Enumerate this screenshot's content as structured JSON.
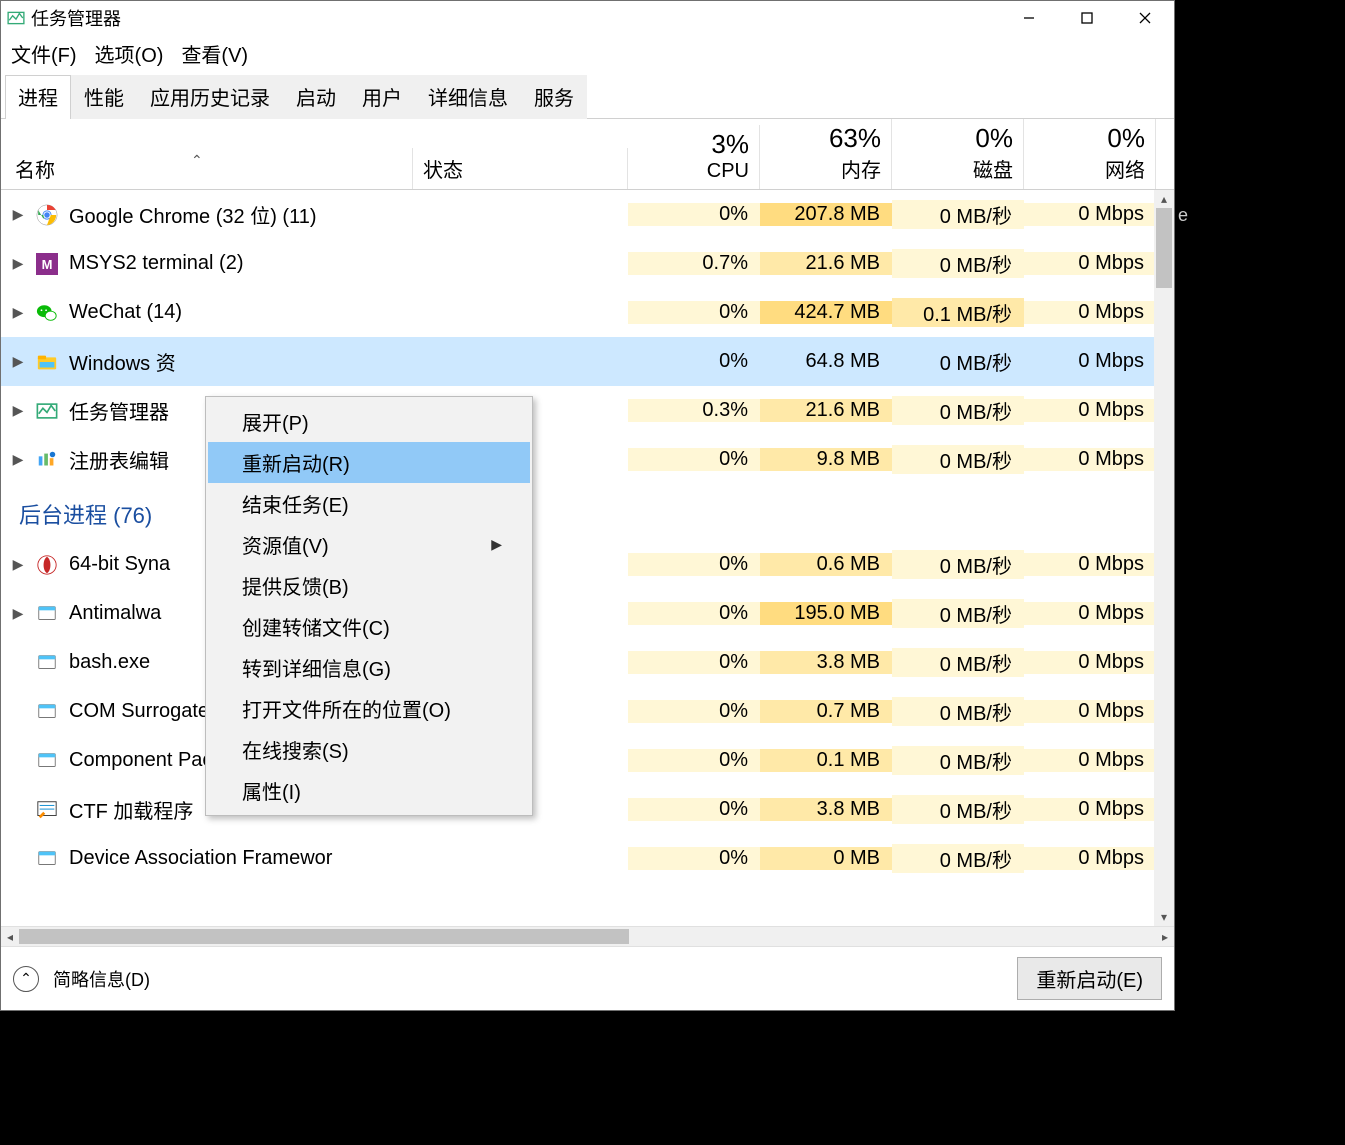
{
  "window": {
    "title": "任务管理器"
  },
  "menubar": {
    "file": "文件(F)",
    "options": "选项(O)",
    "view": "查看(V)"
  },
  "tabs": {
    "items": [
      {
        "label": "进程",
        "active": true
      },
      {
        "label": "性能",
        "active": false
      },
      {
        "label": "应用历史记录",
        "active": false
      },
      {
        "label": "启动",
        "active": false
      },
      {
        "label": "用户",
        "active": false
      },
      {
        "label": "详细信息",
        "active": false
      },
      {
        "label": "服务",
        "active": false
      }
    ]
  },
  "columns": {
    "name": "名称",
    "status": "状态",
    "metrics": [
      {
        "value": "3%",
        "label": "CPU"
      },
      {
        "value": "63%",
        "label": "内存"
      },
      {
        "value": "0%",
        "label": "磁盘"
      },
      {
        "value": "0%",
        "label": "网络"
      }
    ]
  },
  "group_bg_label": "后台进程 (76)",
  "processes": [
    {
      "expandable": true,
      "icon": "chrome",
      "name": "Google Chrome (32 位) (11)",
      "cpu": "0%",
      "mem": "207.8 MB",
      "disk": "0 MB/秒",
      "net": "0 Mbps",
      "heat": [
        "low",
        "hi",
        "low",
        "low"
      ],
      "selected": false
    },
    {
      "expandable": true,
      "icon": "msys",
      "name": "MSYS2 terminal (2)",
      "cpu": "0.7%",
      "mem": "21.6 MB",
      "disk": "0 MB/秒",
      "net": "0 Mbps",
      "heat": [
        "low",
        "med",
        "low",
        "low"
      ],
      "selected": false
    },
    {
      "expandable": true,
      "icon": "wechat",
      "name": "WeChat (14)",
      "cpu": "0%",
      "mem": "424.7 MB",
      "disk": "0.1 MB/秒",
      "net": "0 Mbps",
      "heat": [
        "low",
        "hi",
        "med",
        "low"
      ],
      "selected": false
    },
    {
      "expandable": true,
      "icon": "explorer",
      "name": "Windows 资",
      "cpu": "0%",
      "mem": "64.8 MB",
      "disk": "0 MB/秒",
      "net": "0 Mbps",
      "heat": [
        "low",
        "med",
        "low",
        "low"
      ],
      "selected": true
    },
    {
      "expandable": true,
      "icon": "taskmgr",
      "name": "任务管理器",
      "cpu": "0.3%",
      "mem": "21.6 MB",
      "disk": "0 MB/秒",
      "net": "0 Mbps",
      "heat": [
        "low",
        "med",
        "low",
        "low"
      ],
      "selected": false
    },
    {
      "expandable": true,
      "icon": "regedit",
      "name": "注册表编辑",
      "cpu": "0%",
      "mem": "9.8 MB",
      "disk": "0 MB/秒",
      "net": "0 Mbps",
      "heat": [
        "low",
        "med",
        "low",
        "low"
      ],
      "selected": false
    }
  ],
  "bg_processes": [
    {
      "expandable": true,
      "icon": "synaptic",
      "name": "64-bit Syna",
      "cpu": "0%",
      "mem": "0.6 MB",
      "disk": "0 MB/秒",
      "net": "0 Mbps",
      "heat": [
        "low",
        "med",
        "low",
        "low"
      ]
    },
    {
      "expandable": true,
      "icon": "generic",
      "name": "Antimalwa",
      "cpu": "0%",
      "mem": "195.0 MB",
      "disk": "0 MB/秒",
      "net": "0 Mbps",
      "heat": [
        "low",
        "hi",
        "low",
        "low"
      ]
    },
    {
      "expandable": false,
      "icon": "generic",
      "name": "bash.exe",
      "cpu": "0%",
      "mem": "3.8 MB",
      "disk": "0 MB/秒",
      "net": "0 Mbps",
      "heat": [
        "low",
        "med",
        "low",
        "low"
      ]
    },
    {
      "expandable": false,
      "icon": "generic",
      "name": "COM Surrogate",
      "cpu": "0%",
      "mem": "0.7 MB",
      "disk": "0 MB/秒",
      "net": "0 Mbps",
      "heat": [
        "low",
        "med",
        "low",
        "low"
      ]
    },
    {
      "expandable": false,
      "icon": "generic",
      "name": "Component Package Support...",
      "cpu": "0%",
      "mem": "0.1 MB",
      "disk": "0 MB/秒",
      "net": "0 Mbps",
      "heat": [
        "low",
        "med",
        "low",
        "low"
      ]
    },
    {
      "expandable": false,
      "icon": "ctf",
      "name": "CTF 加载程序",
      "cpu": "0%",
      "mem": "3.8 MB",
      "disk": "0 MB/秒",
      "net": "0 Mbps",
      "heat": [
        "low",
        "med",
        "low",
        "low"
      ]
    },
    {
      "expandable": false,
      "icon": "generic",
      "name": "Device Association Framewor",
      "cpu": "0%",
      "mem": "0 MB",
      "disk": "0 MB/秒",
      "net": "0 Mbps",
      "heat": [
        "low",
        "med",
        "low",
        "low"
      ]
    }
  ],
  "context_menu": {
    "items": [
      {
        "label": "展开(P)",
        "highlighted": false,
        "submenu": false
      },
      {
        "label": "重新启动(R)",
        "highlighted": true,
        "submenu": false
      },
      {
        "label": "结束任务(E)",
        "highlighted": false,
        "submenu": false
      },
      {
        "label": "资源值(V)",
        "highlighted": false,
        "submenu": true
      },
      {
        "label": "提供反馈(B)",
        "highlighted": false,
        "submenu": false
      },
      {
        "label": "创建转储文件(C)",
        "highlighted": false,
        "submenu": false
      },
      {
        "label": "转到详细信息(G)",
        "highlighted": false,
        "submenu": false
      },
      {
        "label": "打开文件所在的位置(O)",
        "highlighted": false,
        "submenu": false
      },
      {
        "label": "在线搜索(S)",
        "highlighted": false,
        "submenu": false
      },
      {
        "label": "属性(I)",
        "highlighted": false,
        "submenu": false
      }
    ]
  },
  "footer": {
    "fewer_details": "简略信息(D)",
    "restart_button": "重新启动(E)"
  },
  "stray_char": "e"
}
